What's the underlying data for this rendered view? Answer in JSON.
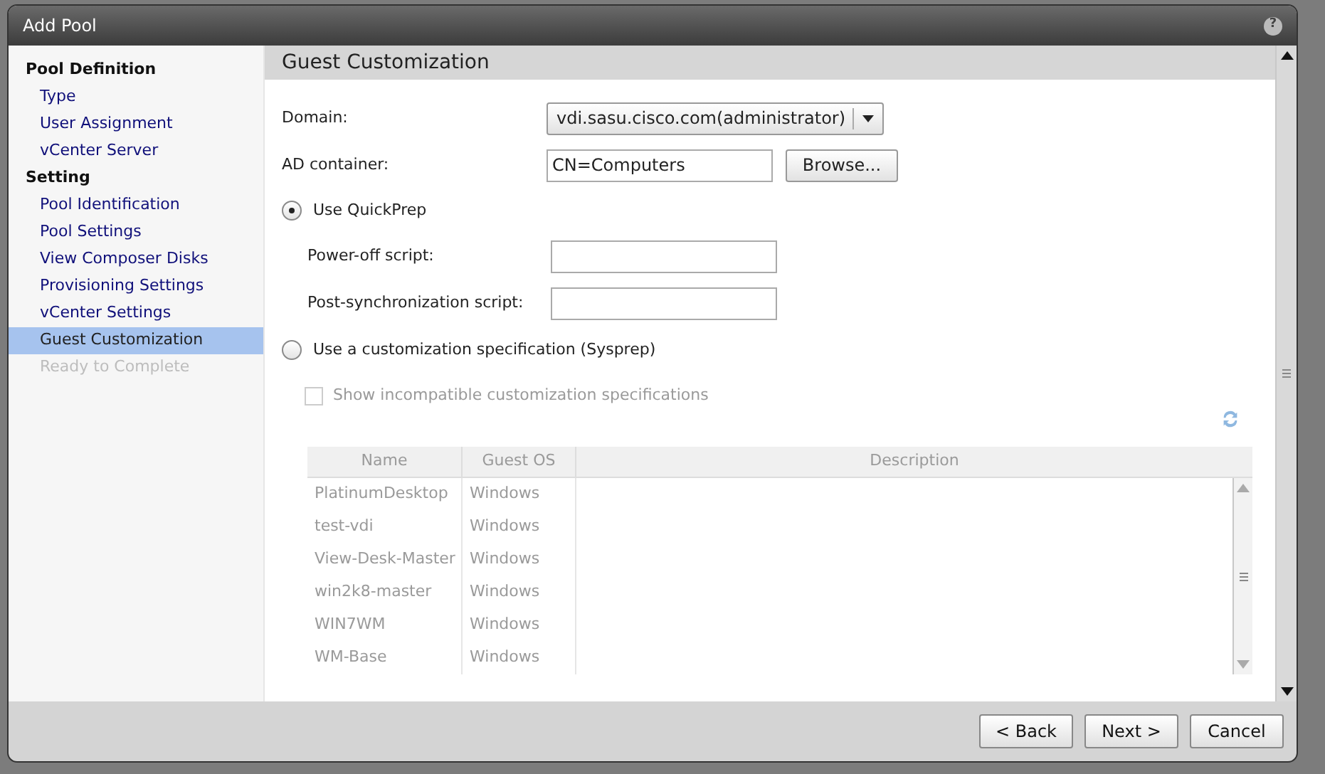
{
  "window": {
    "title": "Add Pool",
    "help": "?"
  },
  "sidebar": {
    "sections": [
      {
        "title": "Pool Definition",
        "items": [
          {
            "label": "Type",
            "selected": false,
            "disabled": false
          },
          {
            "label": "User Assignment",
            "selected": false,
            "disabled": false
          },
          {
            "label": "vCenter Server",
            "selected": false,
            "disabled": false
          }
        ]
      },
      {
        "title": "Setting",
        "items": [
          {
            "label": "Pool Identification",
            "selected": false,
            "disabled": false
          },
          {
            "label": "Pool Settings",
            "selected": false,
            "disabled": false
          },
          {
            "label": "View Composer Disks",
            "selected": false,
            "disabled": false
          },
          {
            "label": "Provisioning Settings",
            "selected": false,
            "disabled": false
          },
          {
            "label": "vCenter Settings",
            "selected": false,
            "disabled": false
          },
          {
            "label": "Guest Customization",
            "selected": true,
            "disabled": false
          },
          {
            "label": "Ready to Complete",
            "selected": false,
            "disabled": true
          }
        ]
      }
    ]
  },
  "content": {
    "header": "Guest Customization",
    "domain": {
      "label": "Domain:",
      "value": "vdi.sasu.cisco.com(administrator)"
    },
    "ad_container": {
      "label": "AD container:",
      "value": "CN=Computers",
      "button": "Browse..."
    },
    "quickprep": {
      "label": "Use QuickPrep",
      "selected": true,
      "fields": [
        {
          "label": "Power-off script:"
        },
        {
          "label": "Post-synchronization script:"
        }
      ]
    },
    "sysprep": {
      "label": "Use a customization specification (Sysprep)",
      "selected": false,
      "disabled": true,
      "checkbox": {
        "label": "Show incompatible customization specifications",
        "checked": false
      },
      "table": {
        "columns": [
          "Name",
          "Guest OS",
          "Description"
        ],
        "rows": [
          [
            "PlatinumDesktop",
            "Windows"
          ],
          [
            "test-vdi",
            "Windows"
          ],
          [
            "View-Desk-Master",
            "Windows"
          ],
          [
            "win2k8-master",
            "Windows"
          ],
          [
            "WIN7WM",
            "Windows"
          ],
          [
            "WM-Base",
            "Windows"
          ]
        ]
      }
    }
  },
  "buttons": [
    {
      "label": "< Back"
    },
    {
      "label": "Next >"
    },
    {
      "label": "Cancel"
    }
  ]
}
